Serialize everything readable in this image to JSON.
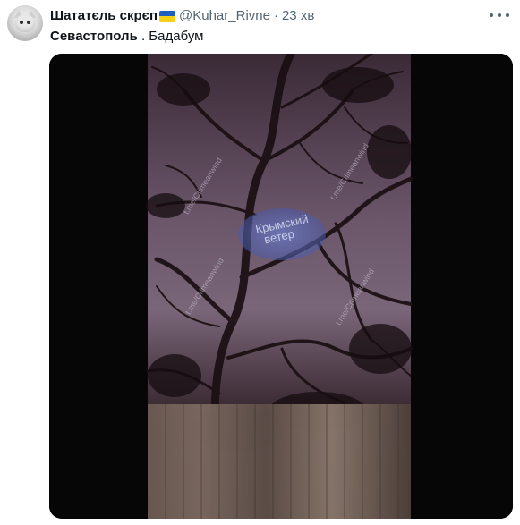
{
  "tweet": {
    "author": {
      "name": "Шататєль скрєп",
      "handle": "@Kuhar_Rivne",
      "flag_colors": [
        "#1f5fc0",
        "#f7d116"
      ]
    },
    "separator": "·",
    "time": "23 хв",
    "text": {
      "hashtag": "Севастополь",
      "rest": " . Бадабум"
    },
    "media": {
      "type": "video",
      "watermarks": [
        "t.me/Crimeanwind",
        "t.me/Crimeanwind",
        "t.me/Crimeanwind",
        "t.me/Crimeanwind"
      ],
      "logo_lines": [
        "Крымский",
        "ветер"
      ]
    }
  }
}
